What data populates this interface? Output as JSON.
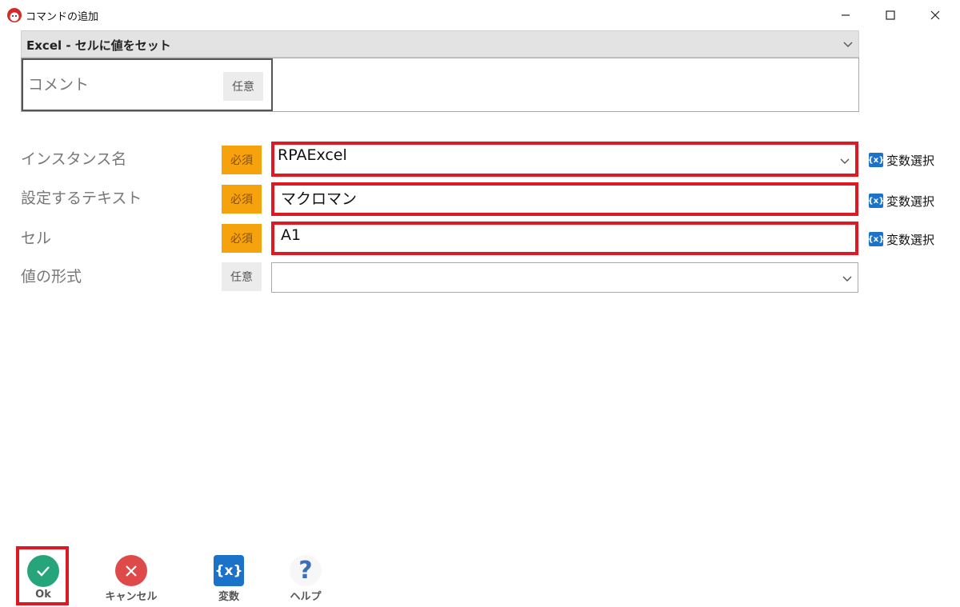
{
  "window": {
    "title": "コマンドの追加"
  },
  "command": {
    "selected": "Excel - セルに値をセット"
  },
  "comment": {
    "label": "コメント",
    "badge": "任意",
    "value": ""
  },
  "fields": [
    {
      "label": "インスタンス名",
      "badge": "必須",
      "value": "RPAExcel",
      "dropdown": true,
      "highlighted": true,
      "var_link": "変数選択"
    },
    {
      "label": "設定するテキスト",
      "badge": "必須",
      "value": "マクロマン",
      "dropdown": false,
      "highlighted": true,
      "var_link": "変数選択"
    },
    {
      "label": "セル",
      "badge": "必須",
      "value": "A1",
      "dropdown": false,
      "highlighted": true,
      "var_link": "変数選択"
    },
    {
      "label": "値の形式",
      "badge": "任意",
      "value": "",
      "dropdown": true,
      "highlighted": false
    }
  ],
  "var_icon_text": "{x}",
  "toolbar": {
    "ok_label": "Ok",
    "cancel_label": "キャンセル",
    "variable_label": "変数",
    "help_label": "ヘルプ",
    "variable_icon_text": "{x}",
    "help_icon_text": "?"
  },
  "colors": {
    "required": "#f5a20c",
    "highlight": "#e01822",
    "ok": "#27a57a",
    "cancel": "#de4a4a",
    "variable": "#1a73c9",
    "help": "#3b6fb6"
  }
}
